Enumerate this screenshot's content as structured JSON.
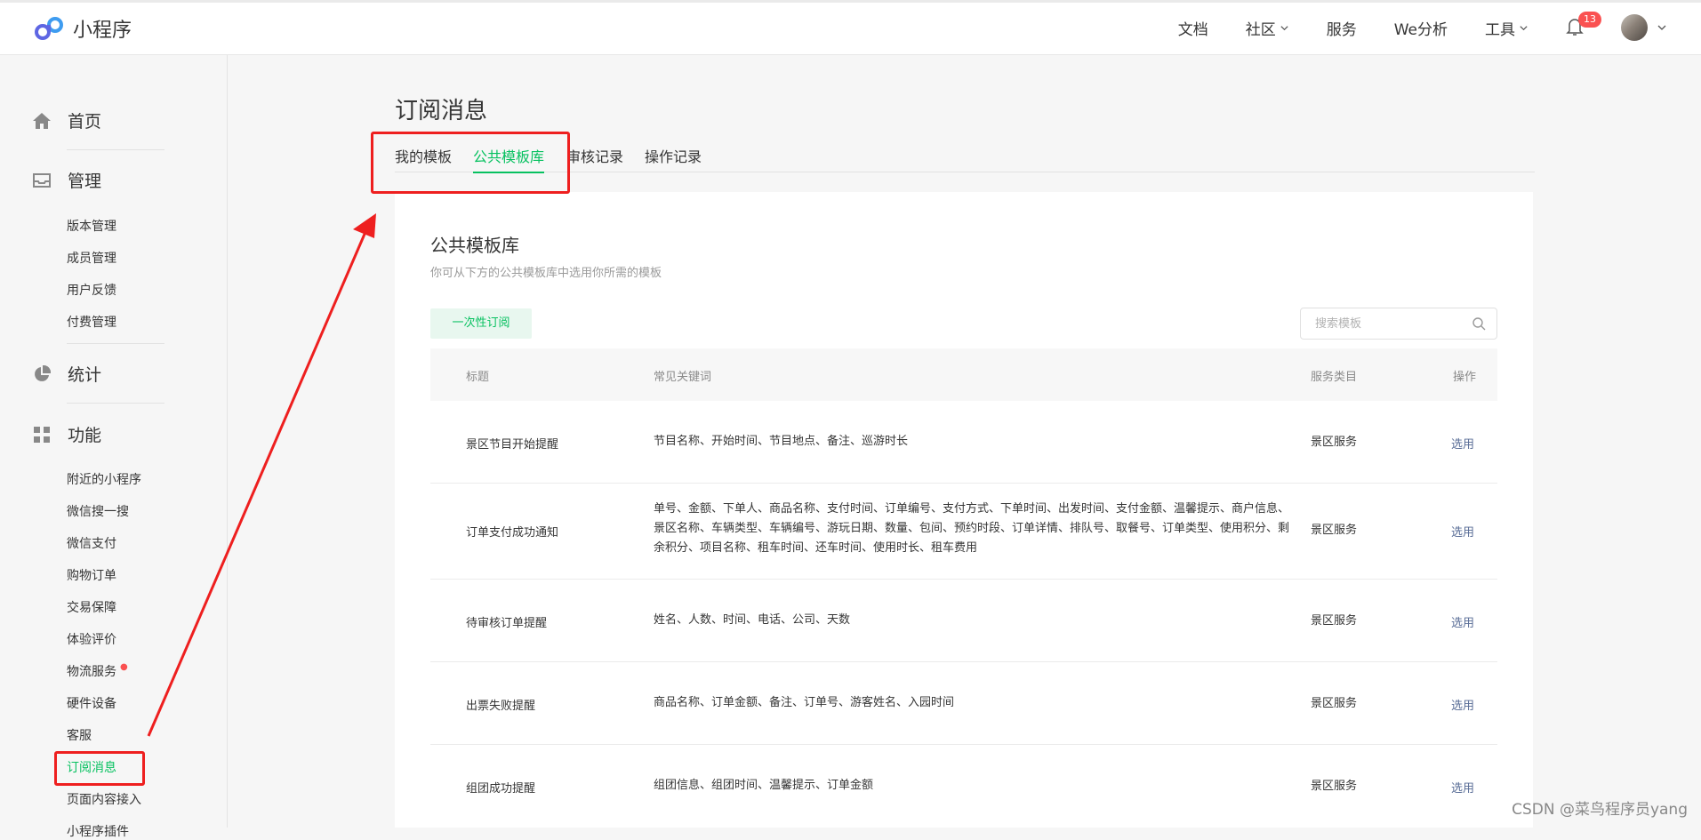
{
  "header": {
    "logo_text": "小程序",
    "nav": [
      {
        "label": "文档",
        "dropdown": false
      },
      {
        "label": "社区",
        "dropdown": true
      },
      {
        "label": "服务",
        "dropdown": false
      },
      {
        "label": "We分析",
        "dropdown": false
      },
      {
        "label": "工具",
        "dropdown": true
      }
    ],
    "notification_count": "13"
  },
  "sidebar": {
    "home": "首页",
    "manage": {
      "label": "管理",
      "items": [
        "版本管理",
        "成员管理",
        "用户反馈",
        "付费管理"
      ]
    },
    "stats": "统计",
    "features": {
      "label": "功能",
      "items": [
        "附近的小程序",
        "微信搜一搜",
        "微信支付",
        "购物订单",
        "交易保障",
        "体验评价",
        "物流服务",
        "硬件设备",
        "客服",
        "订阅消息",
        "页面内容接入",
        "小程序插件"
      ]
    },
    "active_item": "订阅消息"
  },
  "main": {
    "title": "订阅消息",
    "tabs": [
      "我的模板",
      "公共模板库",
      "审核记录",
      "操作记录"
    ],
    "active_tab": "公共模板库",
    "card": {
      "title": "公共模板库",
      "desc": "你可从下方的公共模板库中选用你所需的模板",
      "type_button": "一次性订阅",
      "search_placeholder": "搜索模板",
      "columns": [
        "标题",
        "常见关键词",
        "服务类目",
        "操作"
      ],
      "rows": [
        {
          "title": "景区节目开始提醒",
          "keywords": "节目名称、开始时间、节目地点、备注、巡游时长",
          "category": "景区服务",
          "action": "选用"
        },
        {
          "title": "订单支付成功通知",
          "keywords": "单号、金额、下单人、商品名称、支付时间、订单编号、支付方式、下单时间、出发时间、支付金额、温馨提示、商户信息、景区名称、车辆类型、车辆编号、游玩日期、数量、包间、预约时段、订单详情、排队号、取餐号、订单类型、使用积分、剩余积分、项目名称、租车时间、还车时间、使用时长、租车费用",
          "category": "景区服务",
          "action": "选用"
        },
        {
          "title": "待审核订单提醒",
          "keywords": "姓名、人数、时间、电话、公司、天数",
          "category": "景区服务",
          "action": "选用"
        },
        {
          "title": "出票失败提醒",
          "keywords": "商品名称、订单金额、备注、订单号、游客姓名、入园时间",
          "category": "景区服务",
          "action": "选用"
        },
        {
          "title": "组团成功提醒",
          "keywords": "组团信息、组团时间、温馨提示、订单金额",
          "category": "景区服务",
          "action": "选用"
        }
      ]
    }
  },
  "watermark": "CSDN @菜鸟程序员yang",
  "colors": {
    "accent": "#07c160",
    "link": "#576b95",
    "annotation": "#ee1f1f",
    "badge": "#fa5151"
  }
}
